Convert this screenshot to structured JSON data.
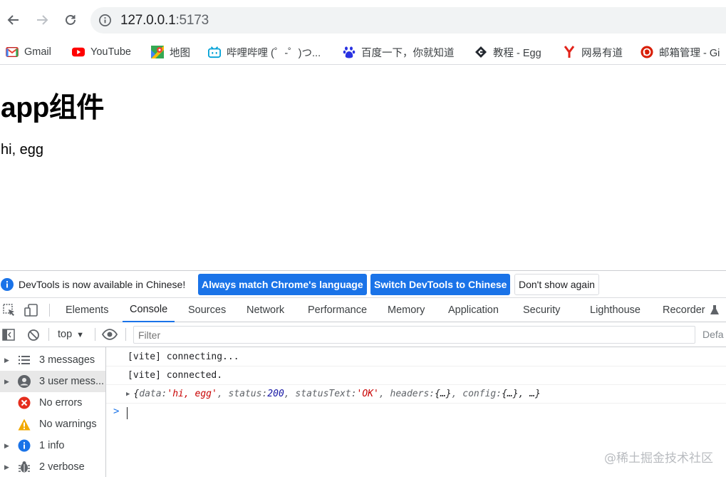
{
  "browser": {
    "url_host": "127.0.0.1",
    "url_port": ":5173",
    "bookmarks": [
      {
        "label": "Gmail",
        "icon": "gmail-icon"
      },
      {
        "label": "YouTube",
        "icon": "youtube-icon"
      },
      {
        "label": "地图",
        "icon": "maps-icon"
      },
      {
        "label": "哔哩哔哩 (゜-゜)つ...",
        "icon": "bilibili-icon"
      },
      {
        "label": "百度一下，你就知道",
        "icon": "baidu-icon"
      },
      {
        "label": "教程 - Egg",
        "icon": "egg-icon"
      },
      {
        "label": "网易有道",
        "icon": "youdao-icon"
      },
      {
        "label": "邮箱管理 - Gi",
        "icon": "mail-admin-icon"
      }
    ]
  },
  "page": {
    "title": "app组件",
    "text": "hi, egg"
  },
  "devtools": {
    "infobar": {
      "message": "DevTools is now available in Chinese!",
      "btn_match": "Always match Chrome's language",
      "btn_switch": "Switch DevTools to Chinese",
      "btn_dismiss": "Don't show again"
    },
    "tabs": [
      "Elements",
      "Console",
      "Sources",
      "Network",
      "Performance",
      "Memory",
      "Application",
      "Security",
      "Lighthouse",
      "Recorder"
    ],
    "active_tab": "Console",
    "context": "top",
    "filter_placeholder": "Filter",
    "levels_label": "Defa",
    "sidebar": [
      {
        "label": "3 messages",
        "icon": "list-icon"
      },
      {
        "label": "3 user mess...",
        "icon": "user-icon"
      },
      {
        "label": "No errors",
        "icon": "error-icon"
      },
      {
        "label": "No warnings",
        "icon": "warning-icon"
      },
      {
        "label": "1 info",
        "icon": "info-icon"
      },
      {
        "label": "2 verbose",
        "icon": "verbose-icon"
      }
    ],
    "console": {
      "line1": "[vite] connecting...",
      "line2": "[vite] connected.",
      "obj": {
        "open": "{",
        "k_data": "data: ",
        "v_data": "'hi, egg'",
        "k_status": ", status: ",
        "v_status": "200",
        "k_statusText": ", statusText: ",
        "v_statusText": "'OK'",
        "k_headers": ", headers: ",
        "v_headers": "{…}",
        "k_config": ", config: ",
        "v_config": "{…}",
        "tail": ", …}"
      }
    }
  },
  "watermark": "@稀土掘金技术社区",
  "colors": {
    "accent": "#1a73e8",
    "string": "#c80000",
    "number": "#1a1aa6"
  }
}
